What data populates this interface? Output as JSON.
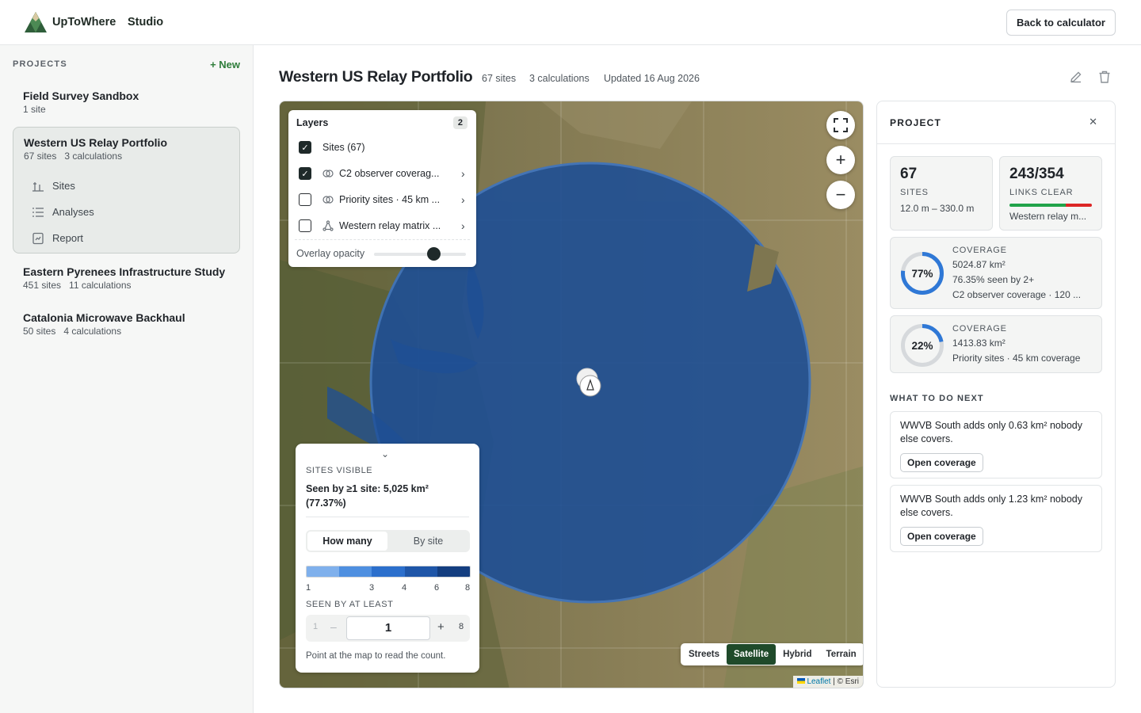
{
  "app": {
    "brand": "UpToWhere",
    "section": "Studio",
    "back_label": "Back to calculator"
  },
  "sidebar": {
    "header": "PROJECTS",
    "new_label": "+ New",
    "projects": [
      {
        "name": "Field Survey Sandbox",
        "sites": "1 site",
        "calcs": ""
      },
      {
        "name": "Western US Relay Portfolio",
        "sites": "67 sites",
        "calcs": "3 calculations",
        "subnav": [
          "Sites",
          "Analyses",
          "Report"
        ]
      },
      {
        "name": "Eastern Pyrenees Infrastructure Study",
        "sites": "451 sites",
        "calcs": "11 calculations"
      },
      {
        "name": "Catalonia Microwave Backhaul",
        "sites": "50 sites",
        "calcs": "4 calculations"
      }
    ]
  },
  "header": {
    "title": "Western US Relay Portfolio",
    "sites": "67 sites",
    "calcs": "3 calculations",
    "updated": "Updated 16 Aug 2026"
  },
  "map": {
    "layers": {
      "title": "Layers",
      "count": "2",
      "items": [
        {
          "label": "Sites (67)",
          "checked": true,
          "icon": ""
        },
        {
          "label": "C2 observer coverag...",
          "checked": true,
          "icon": "coverage-icon"
        },
        {
          "label": "Priority sites · 45 km ...",
          "checked": false,
          "icon": "coverage-icon"
        },
        {
          "label": "Western relay matrix ...",
          "checked": false,
          "icon": "network-icon"
        }
      ],
      "opacity_label": "Overlay opacity",
      "opacity_value": 0.75
    },
    "legend": {
      "caption": "SITES VISIBLE",
      "seen": "Seen by ≥1 site: 5,025 km² (77.37%)",
      "tab_active": "How many",
      "tab_other": "By site",
      "ramp_colors": [
        "#7fb0ec",
        "#4e8fe0",
        "#2c6fcc",
        "#1f56a8",
        "#143e80"
      ],
      "ticks": [
        "1",
        "3",
        "4",
        "6",
        "8"
      ],
      "min_caption": "SEEN BY AT LEAST",
      "min": "1",
      "value": "1",
      "max": "8",
      "hint": "Point at the map to read the count."
    },
    "basemaps": [
      "Streets",
      "Satellite",
      "Hybrid",
      "Terrain"
    ],
    "basemap_active": "Satellite",
    "attribution_link": "Leaflet",
    "attribution_rest": "| © Esri"
  },
  "panel": {
    "title": "PROJECT",
    "sites_count": "67",
    "sites_caption": "SITES",
    "sites_range": "12.0 m – 330.0 m",
    "links": "243/354",
    "links_caption": "LINKS CLEAR",
    "links_sub": "Western relay m...",
    "links_clear_fraction": 0.686,
    "coverage": [
      {
        "pct": "77%",
        "pct_value": 0.77,
        "caption": "COVERAGE",
        "area": "5024.87 km²",
        "extra": "76.35% seen by 2+",
        "name": "C2 observer coverage · 120 ..."
      },
      {
        "pct": "22%",
        "pct_value": 0.22,
        "caption": "COVERAGE",
        "area": "1413.83 km²",
        "extra": "",
        "name": "Priority sites · 45 km coverage"
      }
    ],
    "next_title": "WHAT TO DO NEXT",
    "next": [
      {
        "text": "WWVB South adds only 0.63 km² nobody else covers.",
        "button": "Open coverage"
      },
      {
        "text": "WWVB South adds only 1.23 km² nobody else covers.",
        "button": "Open coverage"
      }
    ]
  },
  "colors": {
    "accent": "#2e7d3a",
    "coverage": "#2a5a9c",
    "link_ok": "#21a34a",
    "link_bad": "#dc2626",
    "ring": "#2f78d6"
  }
}
